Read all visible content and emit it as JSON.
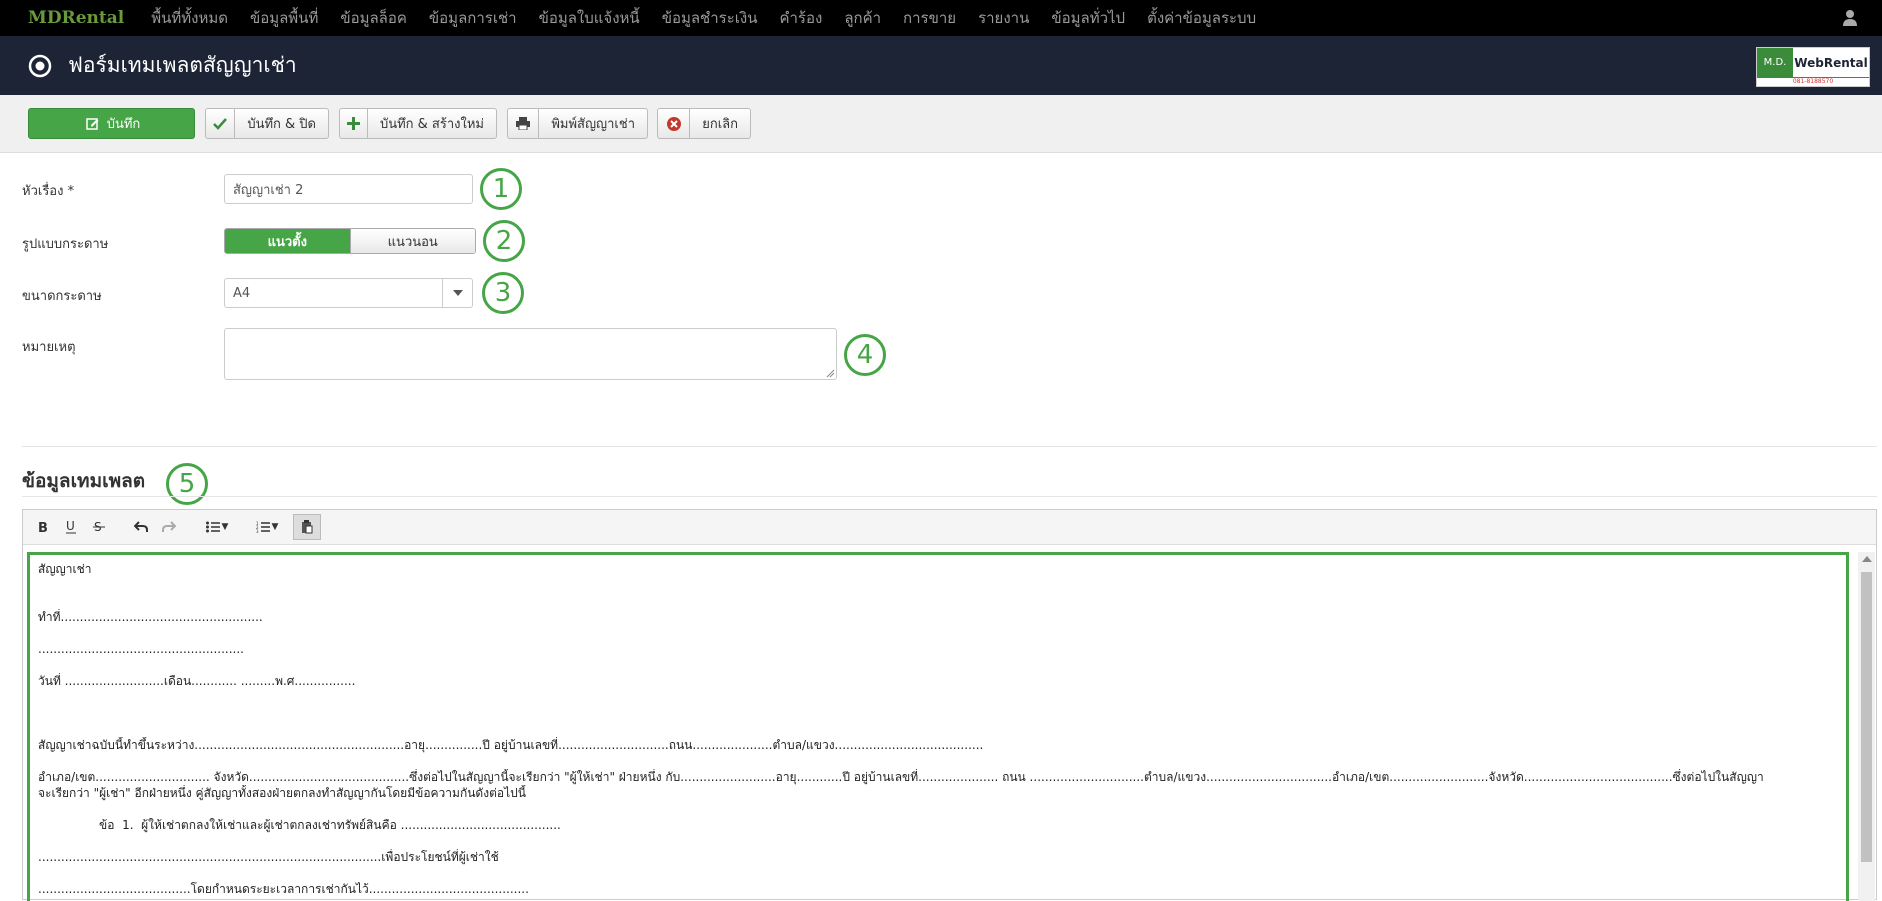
{
  "nav": {
    "brand": "MDRental",
    "items": [
      "พื้นที่ทั้งหมด",
      "ข้อมูลพื้นที่",
      "ข้อมูลล็อค",
      "ข้อมูลการเช่า",
      "ข้อมูลใบแจ้งหนี้",
      "ข้อมูลชำระเงิน",
      "คำร้อง",
      "ลูกค้า",
      "การขาย",
      "รายงาน",
      "ข้อมูลทั่วไป",
      "ตั้งค่าข้อมูลระบบ"
    ],
    "user_icon": "user-icon"
  },
  "header": {
    "title": "ฟอร์มเทมเพลตสัญญาเช่า",
    "logo": {
      "left": "M.D.",
      "right": "WebRental",
      "phone": "081-8188570"
    }
  },
  "toolbar": {
    "save": "บันทึก",
    "save_close": "บันทึก & ปิด",
    "save_new": "บันทึก & สร้างใหม่",
    "print": "พิมพ์สัญญาเช่า",
    "cancel": "ยกเลิก"
  },
  "form": {
    "subject_label": "หัวเรื่อง *",
    "subject_value": "สัญญาเช่า 2",
    "paper_format_label": "รูปแบบกระดาษ",
    "portrait": "แนวตั้ง",
    "landscape": "แนวนอน",
    "paper_size_label": "ขนาดกระดาษ",
    "paper_size_value": "A4",
    "note_label": "หมายเหตุ",
    "note_value": ""
  },
  "annotations": [
    "1",
    "2",
    "3",
    "4",
    "5"
  ],
  "template": {
    "section_title": "ข้อมูลเทมเพลต",
    "lines": [
      "สัญญาเช่า",
      "",
      "",
      "ทำที่.....................................................",
      "",
      "......................................................",
      "",
      "วันที่ ..........................เดือน............ .........พ.ศ................",
      "",
      "",
      "",
      "สัญญาเช่าฉบับนี้ทำขึ้นระหว่าง.......................................................อายุ...............ปี อยู่บ้านเลขที่.............................ถนน.....................ตำบล/แขวง.......................................",
      "",
      "อำเภอ/เขต.............................. จังหวัด..........................................ซึ่งต่อไปในสัญญานี้จะเรียกว่า   \"ผู้ให้เช่า\"   ฝ่ายหนึ่ง   กับ.........................อายุ............ปี อยู่บ้านเลขที่.....................    ถนน ..............................ตำบล/แขวง.................................อำเภอ/เขต..........................จังหวัด.......................................ซึ่งต่อไปในสัญญา",
      "จะเรียกว่า \"ผู้เช่า\"   อีกฝ่ายหนึ่ง คู่สัญญาทั้งสองฝ่ายตกลงทำสัญญากันโดยมีข้อความกันดังต่อไปนี้",
      "",
      "                ข้อ  1.  ผู้ให้เช่าตกลงให้เช่าและผู้เช่าตกลงเช่าทรัพย์สินคือ ..........................................",
      "",
      "..........................................................................................เพื่อประโยชน์ที่ผู้เช่าใช้",
      "",
      "........................................โดยกำหนดระยะเวลาการเช่ากันไว้.........................................."
    ]
  }
}
